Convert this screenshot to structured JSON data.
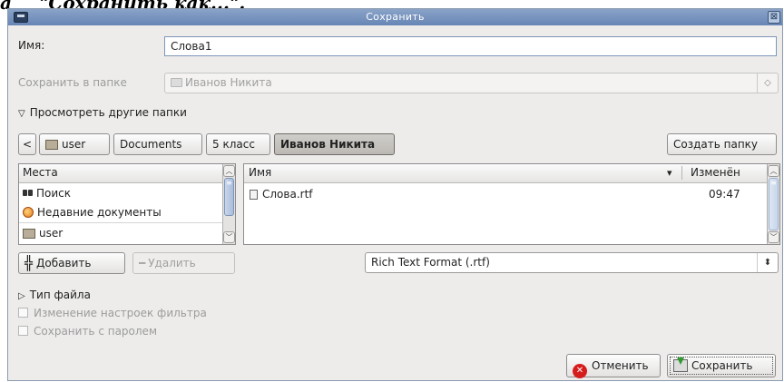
{
  "caption": {
    "prefix": "а",
    "text": "\"Сохранить как...\"."
  },
  "window": {
    "title": "Сохранить",
    "close_glyph": "⊠"
  },
  "form": {
    "name_label": "Имя:",
    "name_value": "Слова1",
    "folder_label": "Сохранить в папке",
    "folder_value": "Иванов Никита",
    "browse_label": "Просмотреть другие папки"
  },
  "pathbar": {
    "back_glyph": "<",
    "crumbs": [
      "user",
      "Documents",
      "5 класс",
      "Иванов Никита"
    ],
    "create_folder_label": "Создать папку"
  },
  "places": {
    "header": "Места",
    "items": [
      {
        "label": "Поиск",
        "icon": "binoculars-icon"
      },
      {
        "label": "Недавние документы",
        "icon": "recent-icon"
      },
      {
        "label": "user",
        "icon": "home-folder-icon"
      }
    ],
    "add_label": "Добавить",
    "remove_label": "Удалить"
  },
  "files": {
    "col_name": "Имя",
    "col_modified": "Изменён",
    "sort_glyph": "▾",
    "rows": [
      {
        "name": "Слова.rtf",
        "modified": "09:47"
      }
    ]
  },
  "filter": {
    "selected": "Rich Text Format (.rtf)"
  },
  "options": {
    "file_type_label": "Тип файла",
    "edit_filter_label": "Изменение настроек фильтра",
    "save_password_label": "Сохранить с паролем"
  },
  "actions": {
    "cancel_label": "Отменить",
    "save_label": "Сохранить"
  }
}
